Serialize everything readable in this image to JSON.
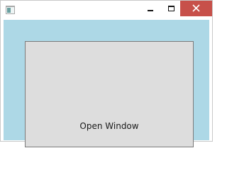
{
  "window": {
    "title": "",
    "controls": {
      "minimize": "minimize-icon",
      "maximize": "maximize-icon",
      "close": "close-icon"
    }
  },
  "client": {
    "background_color": "#ADD8E6",
    "panel_color": "#DDDDDD",
    "button_label": "Open Window"
  },
  "colors": {
    "close_button": "#C7504A"
  }
}
